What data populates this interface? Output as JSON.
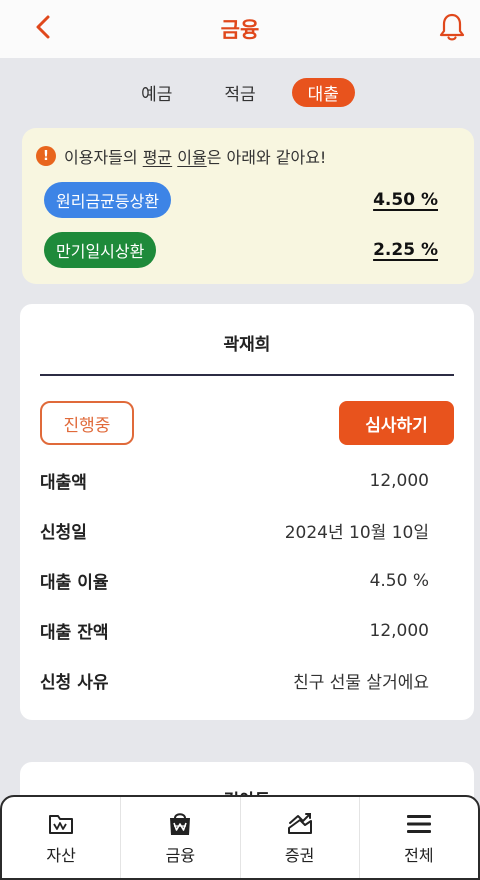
{
  "header": {
    "title": "금융"
  },
  "tabs": [
    {
      "label": "예금",
      "active": false
    },
    {
      "label": "적금",
      "active": false
    },
    {
      "label": "대출",
      "active": true
    }
  ],
  "notice": {
    "prefix": "이용자들의",
    "highlight1": "평균",
    "highlight2": "이율",
    "suffix": "은 아래와 같아요!",
    "rates": [
      {
        "type": "원리금균등상환",
        "value": "4.50 %",
        "color": "#3d84e6"
      },
      {
        "type": "만기일시상환",
        "value": "2.25 %",
        "color": "#1e8a3a"
      }
    ]
  },
  "loan_card": {
    "name": "곽재희",
    "status": "진행중",
    "review_label": "심사하기",
    "rows": [
      {
        "label": "대출액",
        "value": "12,000"
      },
      {
        "label": "신청일",
        "value": "2024년 10월 10일"
      },
      {
        "label": "대출 이율",
        "value": "4.50 %"
      },
      {
        "label": "대출 잔액",
        "value": "12,000"
      },
      {
        "label": "신청 사유",
        "value": "친구 선물 살거에요"
      }
    ]
  },
  "next_card": {
    "name": "김아듀"
  },
  "bottom_nav": [
    {
      "label": "자산",
      "icon": "folder-wallet-icon"
    },
    {
      "label": "금융",
      "icon": "bag-won-icon"
    },
    {
      "label": "증권",
      "icon": "chart-up-icon"
    },
    {
      "label": "전체",
      "icon": "menu-icon"
    }
  ],
  "colors": {
    "accent": "#e8531d",
    "blue": "#3d84e6",
    "green": "#1e8a3a"
  }
}
